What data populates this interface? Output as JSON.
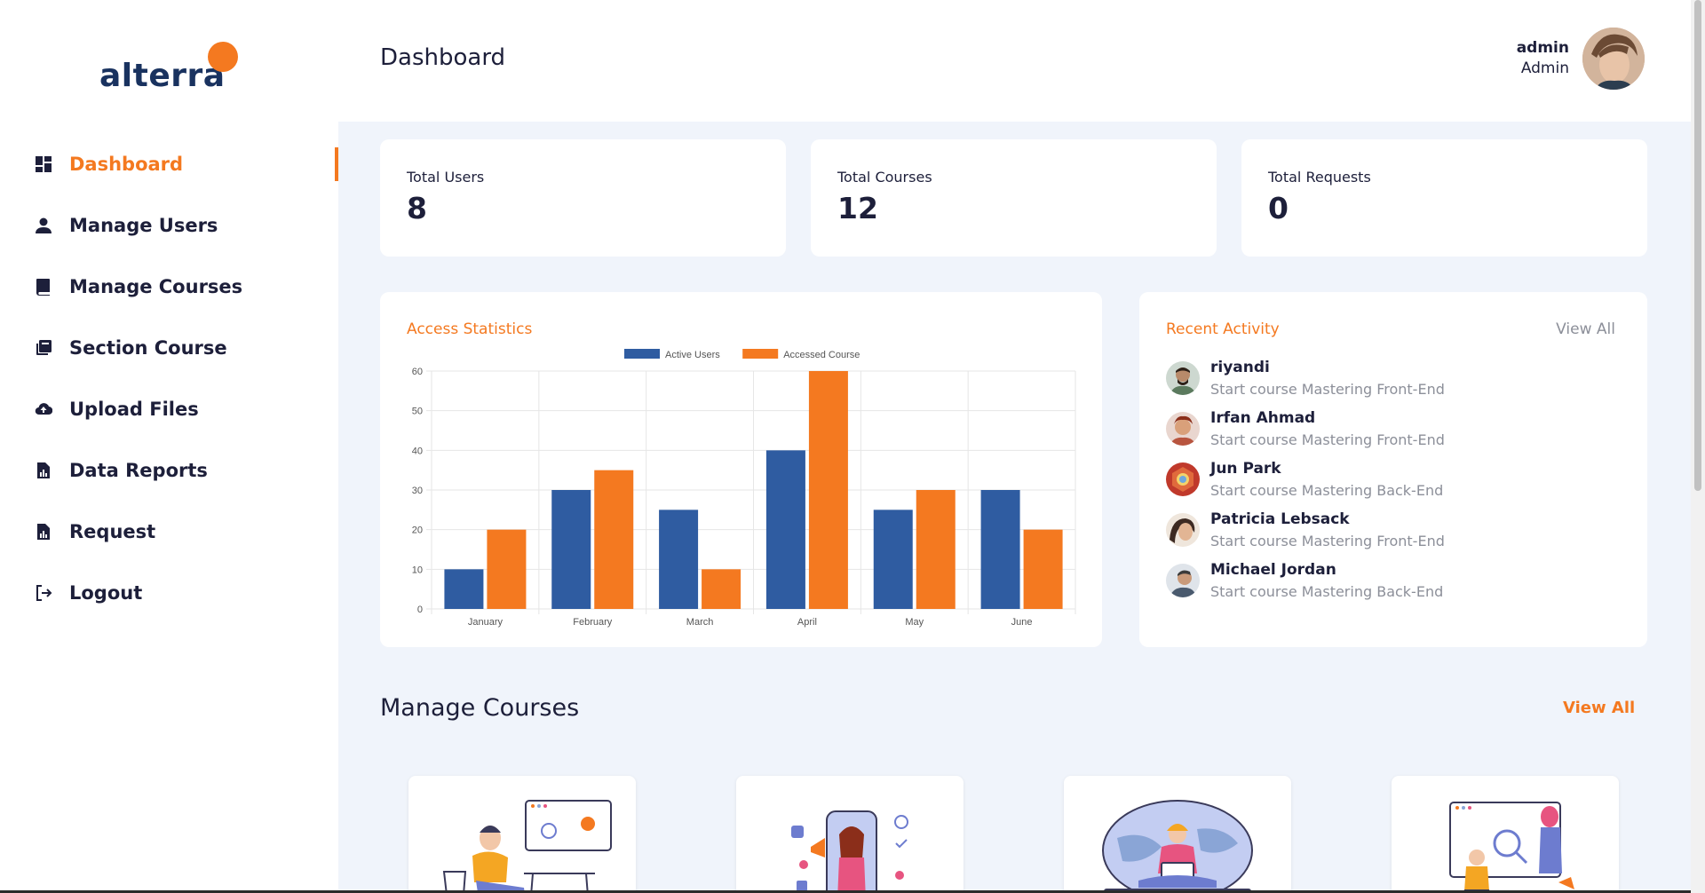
{
  "brand": {
    "logo_text": "alterra",
    "accent": "#f47920",
    "navy": "#19325f"
  },
  "sidebar": {
    "items": [
      {
        "label": "Dashboard",
        "icon": "dashboard-icon",
        "active": true
      },
      {
        "label": "Manage Users",
        "icon": "person-icon"
      },
      {
        "label": "Manage Courses",
        "icon": "book-icon"
      },
      {
        "label": "Section Course",
        "icon": "library-icon"
      },
      {
        "label": "Upload Files",
        "icon": "cloud-upload-icon"
      },
      {
        "label": "Data Reports",
        "icon": "report-icon"
      },
      {
        "label": "Request",
        "icon": "report-icon"
      },
      {
        "label": "Logout",
        "icon": "logout-icon"
      }
    ]
  },
  "header": {
    "title": "Dashboard",
    "user_name": "admin",
    "user_role": "Admin"
  },
  "stats": [
    {
      "label": "Total Users",
      "value": "8"
    },
    {
      "label": "Total Courses",
      "value": "12"
    },
    {
      "label": "Total Requests",
      "value": "0"
    }
  ],
  "chart_card": {
    "title": "Access Statistics"
  },
  "chart_data": {
    "type": "bar",
    "categories": [
      "January",
      "February",
      "March",
      "April",
      "May",
      "June"
    ],
    "series": [
      {
        "name": "Active Users",
        "values": [
          10,
          30,
          25,
          40,
          25,
          30
        ],
        "color": "#2f5ca1"
      },
      {
        "name": "Accessed Course",
        "values": [
          20,
          35,
          10,
          60,
          30,
          20
        ],
        "color": "#f47920"
      }
    ],
    "yticks": [
      "0",
      "10",
      "20",
      "30",
      "40",
      "50",
      "60"
    ],
    "ylim": [
      0,
      60
    ],
    "legend": "top",
    "grid": true
  },
  "activity": {
    "title": "Recent Activity",
    "view_all": "View All",
    "items": [
      {
        "name": "riyandi",
        "desc": "Start course Mastering Front-End",
        "avatar_color": "#5b7a5e"
      },
      {
        "name": "Irfan Ahmad",
        "desc": "Start course Mastering Front-End",
        "avatar_color": "#b8553f"
      },
      {
        "name": "Jun Park",
        "desc": "Start course Mastering Back-End",
        "avatar_color": "#c0392b"
      },
      {
        "name": "Patricia Lebsack",
        "desc": "Start course Mastering Front-End",
        "avatar_color": "#3d2a22"
      },
      {
        "name": "Michael Jordan",
        "desc": "Start course Mastering Back-End",
        "avatar_color": "#4a5a6e"
      }
    ]
  },
  "courses_section": {
    "title": "Manage Courses",
    "view_all": "View All"
  }
}
